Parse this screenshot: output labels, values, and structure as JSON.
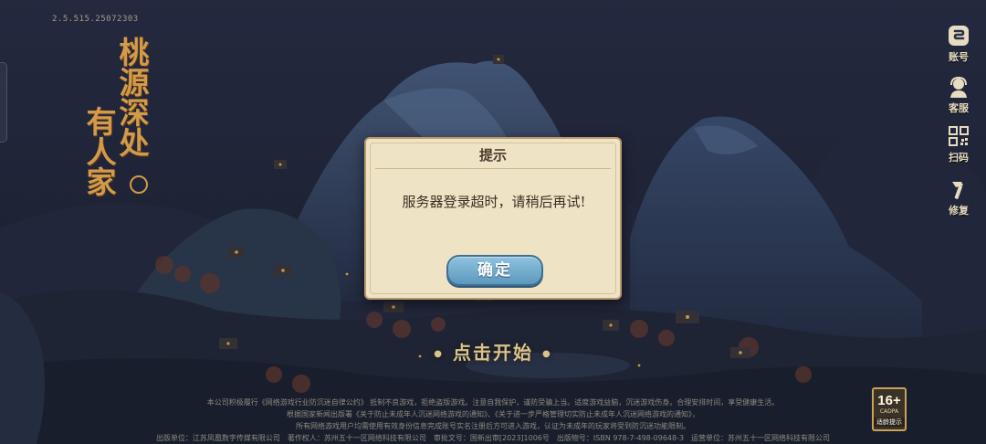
{
  "version": "2.5.515.25072303",
  "logo": {
    "line1": "桃源深处",
    "line2": "有人家"
  },
  "side_menu": [
    {
      "label": "账号",
      "icon": "account-icon"
    },
    {
      "label": "客服",
      "icon": "customer-service-icon"
    },
    {
      "label": "扫码",
      "icon": "qr-scan-icon"
    },
    {
      "label": "修复",
      "icon": "repair-hammer-icon"
    }
  ],
  "start_label": "点击开始",
  "dialog": {
    "title": "提示",
    "message": "服务器登录超时，请稍后再试!",
    "confirm_label": "确定"
  },
  "footer": {
    "line1": "本公司积极履行《网络游戏行业防沉迷自律公约》 抵制不良游戏，拒绝盗版游戏。注意自我保护，谨防受骗上当。适度游戏益脑，沉迷游戏伤身。合理安排时间，享受健康生活。",
    "line2": "根据国家新闻出版署《关于防止未成年人沉迷网络游戏的通知》、《关于进一步严格管理切实防止未成年人沉迷网络游戏的通知》，",
    "line3": "所有网络游戏用户均需使用有效身份信息完成账号实名注册后方可进入游戏，认证为未成年的玩家将受到防沉迷功能限制。",
    "line4": "出版单位：江苏凤凰数字传媒有限公司　著作权人：苏州五十一区网络科技有限公司　审批文号：国新出审[2023]1006号　出版物号：ISBN 978-7-498-09648-3　运营单位：苏州五十一区网络科技有限公司"
  },
  "age_rating": {
    "number": "16+",
    "sub": "CADPA",
    "caption": "适龄提示"
  },
  "colors": {
    "night_sky": "#1f2436",
    "logo_gold": "#d39a4a",
    "dialog_paper": "#efe3c6",
    "button_blue": "#6aa6c9"
  }
}
